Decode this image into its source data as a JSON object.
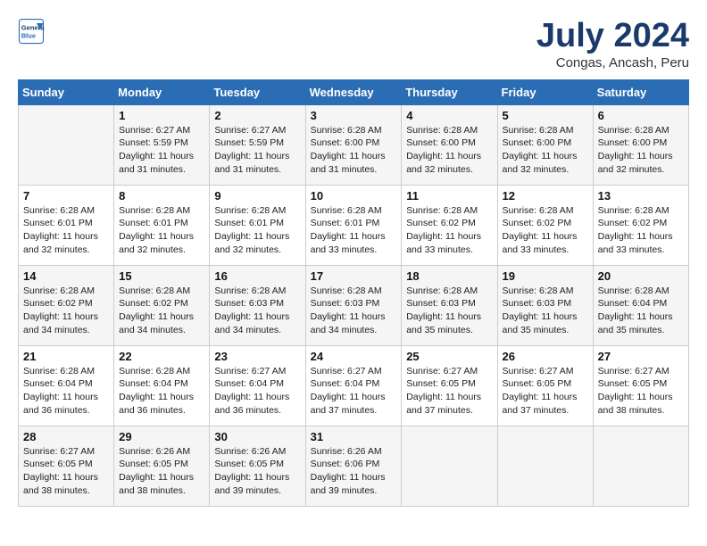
{
  "logo": {
    "line1": "General",
    "line2": "Blue"
  },
  "title": "July 2024",
  "location": "Congas, Ancash, Peru",
  "days_of_week": [
    "Sunday",
    "Monday",
    "Tuesday",
    "Wednesday",
    "Thursday",
    "Friday",
    "Saturday"
  ],
  "weeks": [
    [
      {
        "day": "",
        "info": ""
      },
      {
        "day": "1",
        "info": "Sunrise: 6:27 AM\nSunset: 5:59 PM\nDaylight: 11 hours\nand 31 minutes."
      },
      {
        "day": "2",
        "info": "Sunrise: 6:27 AM\nSunset: 5:59 PM\nDaylight: 11 hours\nand 31 minutes."
      },
      {
        "day": "3",
        "info": "Sunrise: 6:28 AM\nSunset: 6:00 PM\nDaylight: 11 hours\nand 31 minutes."
      },
      {
        "day": "4",
        "info": "Sunrise: 6:28 AM\nSunset: 6:00 PM\nDaylight: 11 hours\nand 32 minutes."
      },
      {
        "day": "5",
        "info": "Sunrise: 6:28 AM\nSunset: 6:00 PM\nDaylight: 11 hours\nand 32 minutes."
      },
      {
        "day": "6",
        "info": "Sunrise: 6:28 AM\nSunset: 6:00 PM\nDaylight: 11 hours\nand 32 minutes."
      }
    ],
    [
      {
        "day": "7",
        "info": "Sunrise: 6:28 AM\nSunset: 6:01 PM\nDaylight: 11 hours\nand 32 minutes."
      },
      {
        "day": "8",
        "info": "Sunrise: 6:28 AM\nSunset: 6:01 PM\nDaylight: 11 hours\nand 32 minutes."
      },
      {
        "day": "9",
        "info": "Sunrise: 6:28 AM\nSunset: 6:01 PM\nDaylight: 11 hours\nand 32 minutes."
      },
      {
        "day": "10",
        "info": "Sunrise: 6:28 AM\nSunset: 6:01 PM\nDaylight: 11 hours\nand 33 minutes."
      },
      {
        "day": "11",
        "info": "Sunrise: 6:28 AM\nSunset: 6:02 PM\nDaylight: 11 hours\nand 33 minutes."
      },
      {
        "day": "12",
        "info": "Sunrise: 6:28 AM\nSunset: 6:02 PM\nDaylight: 11 hours\nand 33 minutes."
      },
      {
        "day": "13",
        "info": "Sunrise: 6:28 AM\nSunset: 6:02 PM\nDaylight: 11 hours\nand 33 minutes."
      }
    ],
    [
      {
        "day": "14",
        "info": "Sunrise: 6:28 AM\nSunset: 6:02 PM\nDaylight: 11 hours\nand 34 minutes."
      },
      {
        "day": "15",
        "info": "Sunrise: 6:28 AM\nSunset: 6:02 PM\nDaylight: 11 hours\nand 34 minutes."
      },
      {
        "day": "16",
        "info": "Sunrise: 6:28 AM\nSunset: 6:03 PM\nDaylight: 11 hours\nand 34 minutes."
      },
      {
        "day": "17",
        "info": "Sunrise: 6:28 AM\nSunset: 6:03 PM\nDaylight: 11 hours\nand 34 minutes."
      },
      {
        "day": "18",
        "info": "Sunrise: 6:28 AM\nSunset: 6:03 PM\nDaylight: 11 hours\nand 35 minutes."
      },
      {
        "day": "19",
        "info": "Sunrise: 6:28 AM\nSunset: 6:03 PM\nDaylight: 11 hours\nand 35 minutes."
      },
      {
        "day": "20",
        "info": "Sunrise: 6:28 AM\nSunset: 6:04 PM\nDaylight: 11 hours\nand 35 minutes."
      }
    ],
    [
      {
        "day": "21",
        "info": "Sunrise: 6:28 AM\nSunset: 6:04 PM\nDaylight: 11 hours\nand 36 minutes."
      },
      {
        "day": "22",
        "info": "Sunrise: 6:28 AM\nSunset: 6:04 PM\nDaylight: 11 hours\nand 36 minutes."
      },
      {
        "day": "23",
        "info": "Sunrise: 6:27 AM\nSunset: 6:04 PM\nDaylight: 11 hours\nand 36 minutes."
      },
      {
        "day": "24",
        "info": "Sunrise: 6:27 AM\nSunset: 6:04 PM\nDaylight: 11 hours\nand 37 minutes."
      },
      {
        "day": "25",
        "info": "Sunrise: 6:27 AM\nSunset: 6:05 PM\nDaylight: 11 hours\nand 37 minutes."
      },
      {
        "day": "26",
        "info": "Sunrise: 6:27 AM\nSunset: 6:05 PM\nDaylight: 11 hours\nand 37 minutes."
      },
      {
        "day": "27",
        "info": "Sunrise: 6:27 AM\nSunset: 6:05 PM\nDaylight: 11 hours\nand 38 minutes."
      }
    ],
    [
      {
        "day": "28",
        "info": "Sunrise: 6:27 AM\nSunset: 6:05 PM\nDaylight: 11 hours\nand 38 minutes."
      },
      {
        "day": "29",
        "info": "Sunrise: 6:26 AM\nSunset: 6:05 PM\nDaylight: 11 hours\nand 38 minutes."
      },
      {
        "day": "30",
        "info": "Sunrise: 6:26 AM\nSunset: 6:05 PM\nDaylight: 11 hours\nand 39 minutes."
      },
      {
        "day": "31",
        "info": "Sunrise: 6:26 AM\nSunset: 6:06 PM\nDaylight: 11 hours\nand 39 minutes."
      },
      {
        "day": "",
        "info": ""
      },
      {
        "day": "",
        "info": ""
      },
      {
        "day": "",
        "info": ""
      }
    ]
  ]
}
